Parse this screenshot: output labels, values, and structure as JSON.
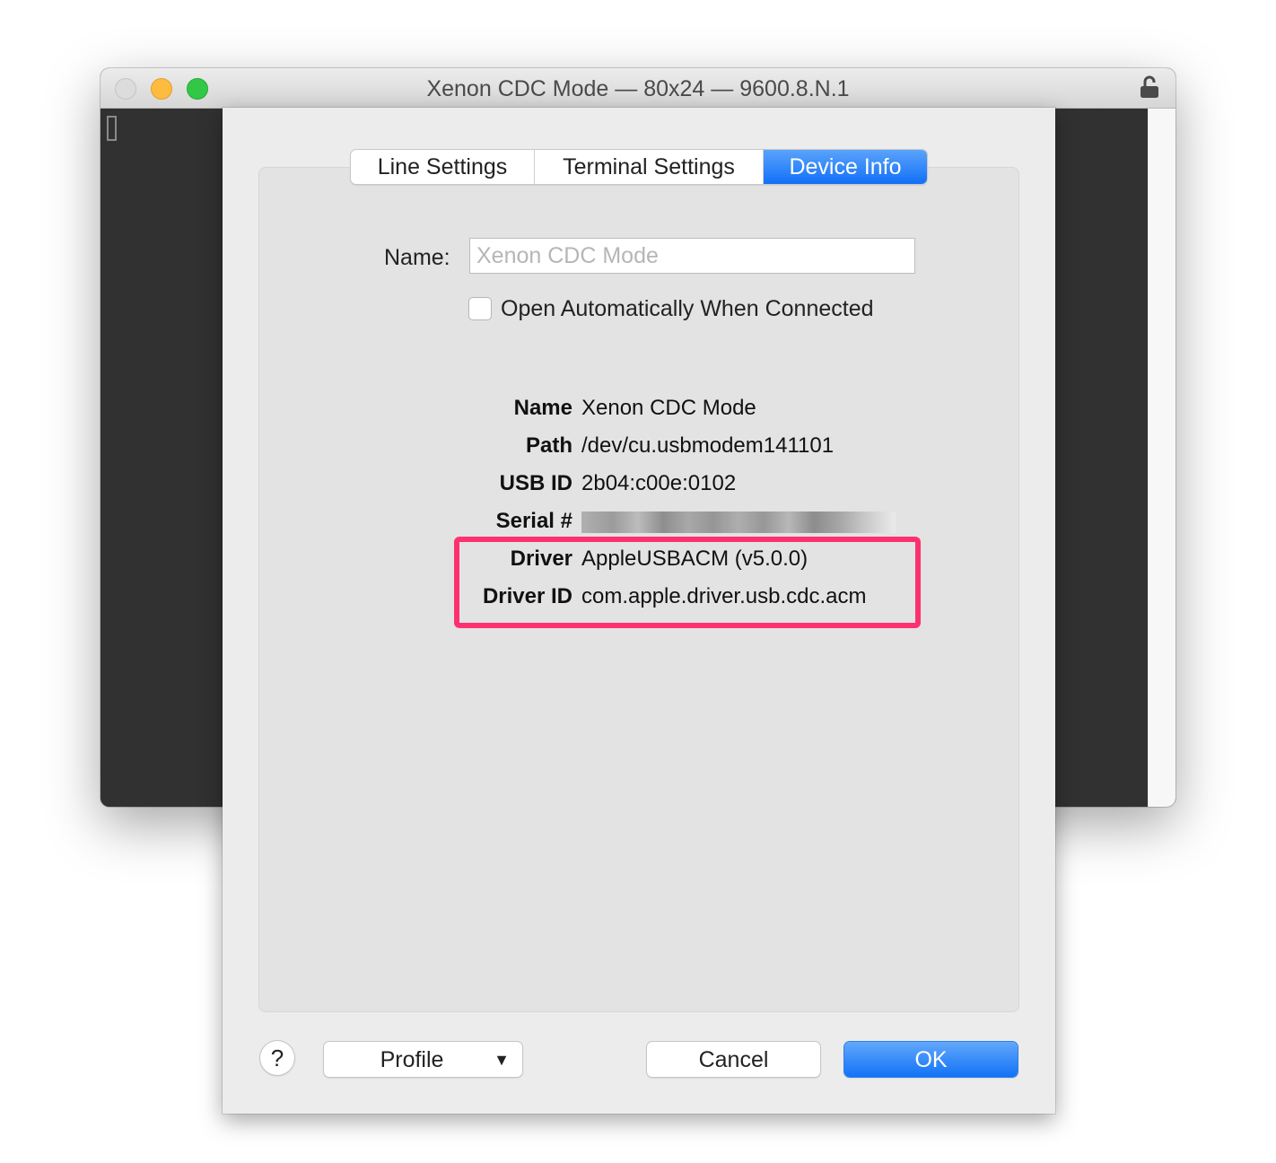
{
  "window": {
    "title": "Xenon CDC Mode — 80x24 — 9600.8.N.1",
    "traffic_lights": [
      "close",
      "minimize",
      "zoom"
    ],
    "lock_icon": "lock-open-icon"
  },
  "dialog": {
    "tabs": [
      {
        "label": "Line Settings",
        "active": false
      },
      {
        "label": "Terminal Settings",
        "active": false
      },
      {
        "label": "Device Info",
        "active": true
      }
    ],
    "name_label": "Name:",
    "name_input": {
      "value": "",
      "placeholder": "Xenon CDC Mode"
    },
    "open_auto": {
      "label": "Open Automatically When Connected",
      "checked": false
    },
    "info": [
      {
        "key": "Name",
        "value": "Xenon CDC Mode"
      },
      {
        "key": "Path",
        "value": "/dev/cu.usbmodem141101"
      },
      {
        "key": "USB ID",
        "value": "2b04:c00e:0102"
      },
      {
        "key": "Serial #",
        "value": "",
        "redacted": true
      },
      {
        "key": "Driver",
        "value": "AppleUSBACM (v5.0.0)",
        "highlighted": true
      },
      {
        "key": "Driver ID",
        "value": "com.apple.driver.usb.cdc.acm",
        "highlighted": true
      }
    ],
    "highlight_color": "#fc3170",
    "accent_color": "#1a76f7",
    "buttons": {
      "help": "?",
      "profile": "Profile",
      "profile_arrow": "▼",
      "cancel": "Cancel",
      "ok": "OK"
    }
  }
}
